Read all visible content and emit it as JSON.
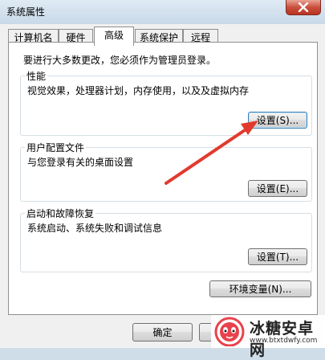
{
  "window": {
    "title": "系统属性",
    "background_title": "",
    "close_icon": "close-icon"
  },
  "tabs": [
    {
      "label": "计算机名",
      "active": false
    },
    {
      "label": "硬件",
      "active": false
    },
    {
      "label": "高级",
      "active": true
    },
    {
      "label": "系统保护",
      "active": false
    },
    {
      "label": "远程",
      "active": false
    }
  ],
  "advanced": {
    "admin_notice": "要进行大多数更改，您必须作为管理员登录。",
    "performance": {
      "title": "性能",
      "description": "视觉效果，处理器计划，内存使用，以及及虚拟内存",
      "settings_button": "设置(S)..."
    },
    "user_profiles": {
      "title": "用户配置文件",
      "description": "与您登录有关的桌面设置",
      "settings_button": "设置(E)..."
    },
    "startup_recovery": {
      "title": "启动和故障恢复",
      "description": "系统启动、系统失败和调试信息",
      "settings_button": "设置(T)..."
    },
    "env_vars_button": "环境变量(N)..."
  },
  "footer": {
    "ok_button": "确定"
  },
  "annotation": {
    "arrow_color": "#e23a2e"
  },
  "watermark": {
    "name": "冰糖安卓网",
    "url": "www.btxtdwfy.com"
  }
}
